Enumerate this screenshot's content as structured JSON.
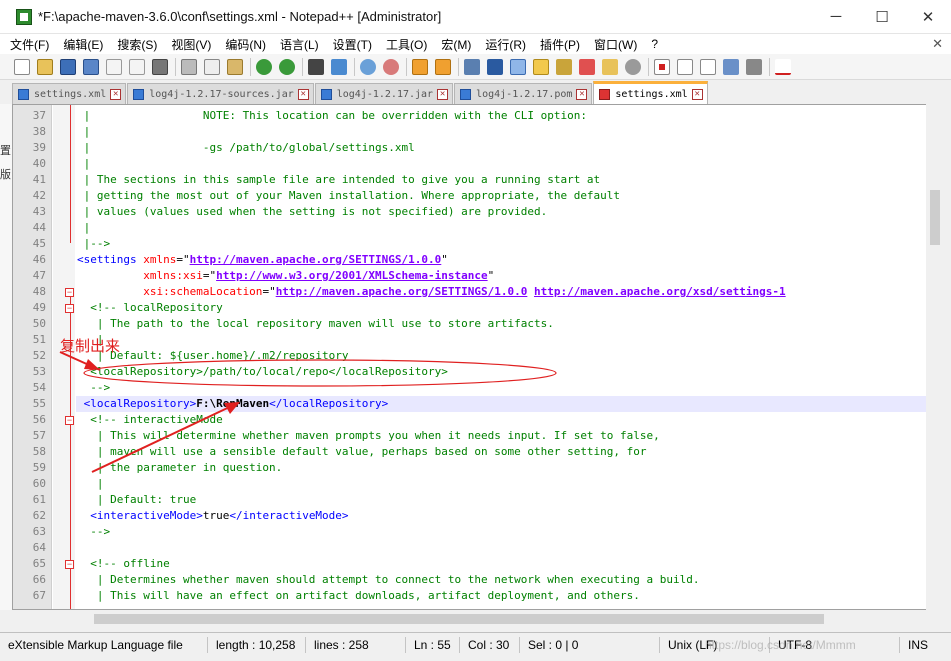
{
  "window": {
    "title": "*F:\\apache-maven-3.6.0\\conf\\settings.xml - Notepad++ [Administrator]",
    "minimize": "─",
    "maximize": "☐",
    "close": "✕"
  },
  "menu": [
    "文件(F)",
    "编辑(E)",
    "搜索(S)",
    "视图(V)",
    "编码(N)",
    "语言(L)",
    "设置(T)",
    "工具(O)",
    "宏(M)",
    "运行(R)",
    "插件(P)",
    "窗口(W)",
    "?"
  ],
  "menu_close": "✕",
  "tabs": [
    {
      "label": "settings.xml",
      "active": false
    },
    {
      "label": "log4j-1.2.17-sources.jar",
      "active": false
    },
    {
      "label": "log4j-1.2.17.jar",
      "active": false
    },
    {
      "label": "log4j-1.2.17.pom",
      "active": false
    },
    {
      "label": "settings.xml",
      "active": true
    }
  ],
  "line_numbers": [
    "37",
    "38",
    "39",
    "40",
    "41",
    "42",
    "43",
    "44",
    "45",
    "46",
    "47",
    "48",
    "49",
    "50",
    "51",
    "52",
    "53",
    "54",
    "55",
    "56",
    "57",
    "58",
    "59",
    "60",
    "61",
    "62",
    "63",
    "64",
    "65",
    "66",
    "67"
  ],
  "code": {
    "l37": " |                 NOTE: This location can be overridden with the CLI option:",
    "l38": " |",
    "l39": " |                 -gs /path/to/global/settings.xml",
    "l40": " |",
    "l41": " | The sections in this sample file are intended to give you a running start at",
    "l42": " | getting the most out of your Maven installation. Where appropriate, the default",
    "l43": " | values (values used when the setting is not specified) are provided.",
    "l44": " |",
    "l45": " |-->",
    "l46_tag": "<settings ",
    "l46_attr": "xmlns",
    "l46_eq": "=",
    "l46_url": "http://maven.apache.org/SETTINGS/1.0.0",
    "l47_attr": "          xmlns:xsi",
    "l47_url": "http://www.w3.org/2001/XMLSchema-instance",
    "l48_attr": "          xsi:schemaLocation",
    "l48_url1": "http://maven.apache.org/SETTINGS/1.0.0",
    "l48_url2": "http://maven.apache.org/xsd/settings-1",
    "l49": "  <!-- localRepository",
    "l50": "   | The path to the local repository maven will use to store artifacts.",
    "l51": "   |",
    "l52": "   | Default: ${user.home}/.m2/repository",
    "l53": "  <localRepository>/path/to/local/repo</localRepository>",
    "l54": "  -->",
    "l55_open": " <localRepository>",
    "l55_text": "F:\\RepMaven",
    "l55_close": "</localRepository>",
    "l56": "  <!-- interactiveMode",
    "l57": "   | This will determine whether maven prompts you when it needs input. If set to false,",
    "l58": "   | maven will use a sensible default value, perhaps based on some other setting, for",
    "l59": "   | the parameter in question.",
    "l60": "   |",
    "l61": "   | Default: true",
    "l62_open": "  <interactiveMode>",
    "l62_text": "true",
    "l62_close": "</interactiveMode>",
    "l63": "  -->",
    "l64": "",
    "l65": "  <!-- offline",
    "l66": "   | Determines whether maven should attempt to connect to the network when executing a build.",
    "l67": "   | This will have an effect on artifact downloads, artifact deployment, and others."
  },
  "annotation": "复制出来",
  "status": {
    "file_type": "eXtensible Markup Language file",
    "length": "length : 10,258",
    "lines": "lines : 258",
    "ln": "Ln : 55",
    "col": "Col : 30",
    "sel": "Sel : 0 | 0",
    "eol": "Unix (LF)",
    "encoding": "UTF-8",
    "ins": "INS",
    "watermark": "https://blog.csdn.net/Mmmm"
  },
  "left_edge_chars": [
    "置",
    "版"
  ],
  "colors": {
    "tag": "#0000ff",
    "attribute": "#ff0000",
    "string": "#8000ff",
    "comment": "#008000",
    "annotation": "#e02020",
    "active_tab_accent": "#fbb03b"
  }
}
